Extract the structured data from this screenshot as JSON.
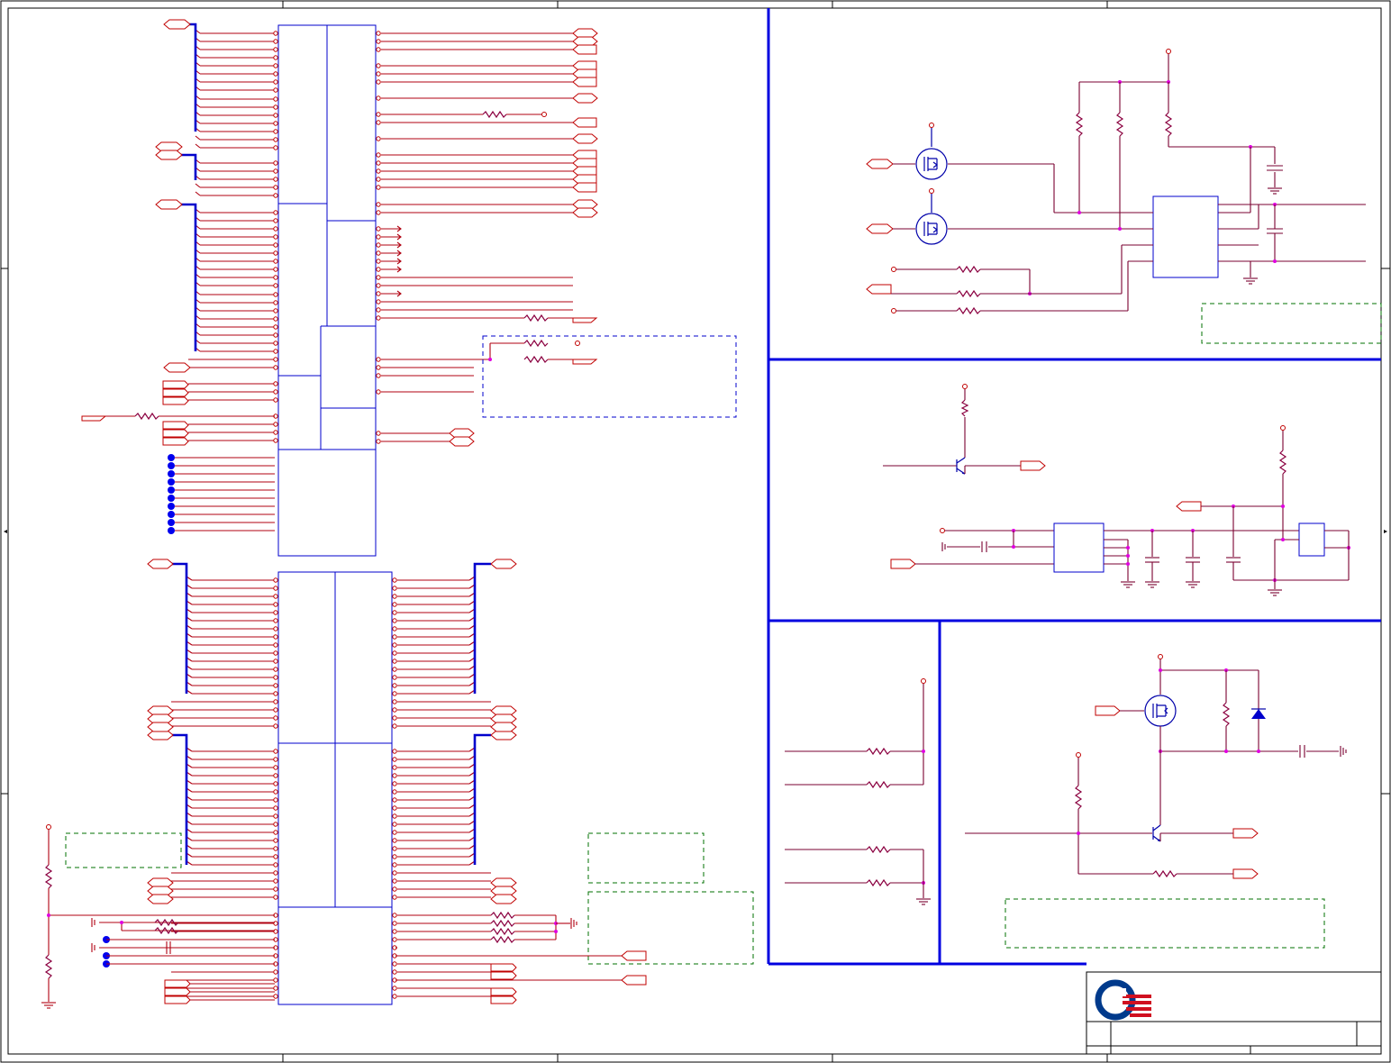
{
  "sheet": {
    "type": "schematic",
    "frame_color": "#000000",
    "wire_color": "#b00010",
    "bus_color": "#0000cc",
    "junction_color": "#e000e0"
  },
  "title_block": {
    "logo": "company-logo",
    "logo_colors": [
      "#003a8c",
      "#d01020"
    ]
  }
}
